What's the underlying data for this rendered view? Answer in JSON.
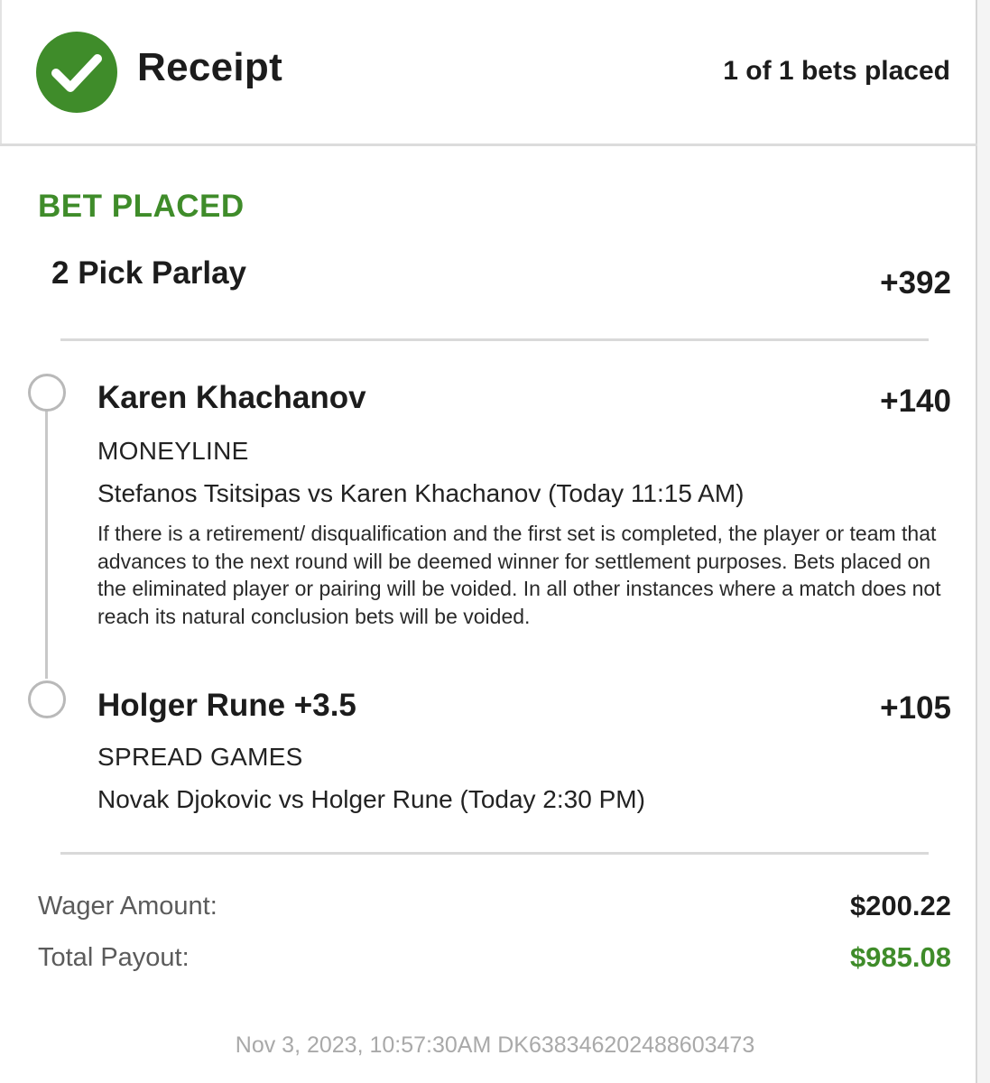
{
  "header": {
    "title": "Receipt",
    "bets_placed": "1 of 1 bets placed",
    "icon": "check-circle-icon",
    "accent_color": "#3f8c2a"
  },
  "bet": {
    "status": "BET PLACED",
    "parlay_title": "2 Pick Parlay",
    "parlay_odds": "+392",
    "picks": [
      {
        "name": "Karen Khachanov",
        "odds": "+140",
        "market": "MONEYLINE",
        "event": "Stefanos Tsitsipas vs Karen Khachanov (Today 11:15 AM)",
        "rules": "If there is a retirement/ disqualification and the first set is completed, the player or team that advances to the next round will be deemed winner for settlement purposes. Bets placed on the eliminated player or pairing will be voided. In all other instances where a match does not reach its natural conclusion bets will be voided."
      },
      {
        "name": "Holger Rune +3.5",
        "odds": "+105",
        "market": "SPREAD GAMES",
        "event": "Novak Djokovic vs Holger Rune (Today 2:30 PM)"
      }
    ]
  },
  "summary": {
    "wager_label": "Wager Amount:",
    "wager_value": "$200.22",
    "payout_label": "Total Payout:",
    "payout_value": "$985.08"
  },
  "footer": {
    "meta": "Nov 3, 2023, 10:57:30AM DK638346202488603473"
  }
}
